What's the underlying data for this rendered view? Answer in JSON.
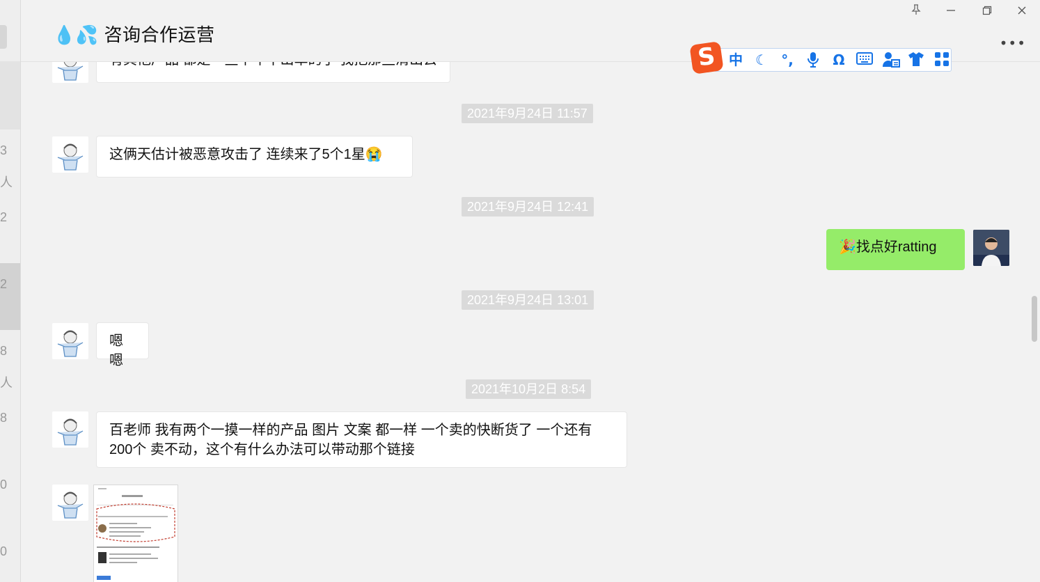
{
  "window": {
    "title": "💧💦 咨询合作运营",
    "pin_icon": "pin-icon",
    "controls": [
      "minimize-icon",
      "restore-icon",
      "close-icon"
    ],
    "more": "•••"
  },
  "left_strip_digits": [
    "3",
    "人",
    "2",
    "2",
    "8",
    "人",
    "8",
    "0",
    "0"
  ],
  "ime_toolbar": {
    "logo": "S",
    "items": [
      "中",
      "☾",
      "°,",
      "mic-icon",
      "Ω",
      "keyboard-icon",
      "user-card-icon",
      "shirt-icon",
      "apps-icon"
    ],
    "accent": "#1673e6",
    "logo_color": "#f25522"
  },
  "messages": {
    "m0": "有其他产品 都是一些半年不出单的了 我把那些清出去",
    "t1": "2021年9月24日 11:57",
    "m1": "这俩天估计被恶意攻击了 连续来了5个1星😭",
    "t2": "2021年9月24日 12:41",
    "m2": "🎉找点好ratting",
    "t3": "2021年9月24日 13:01",
    "m3": "嗯嗯",
    "t4": "2021年10月2日 8:54",
    "m4": "百老师 我有两个一摸一样的产品 图片 文案 都一样 一个卖的快断货了 一个还有200个 卖不动，这个有什么办法可以带动那个链接"
  },
  "colors": {
    "my_bubble": "#95ec69",
    "their_bubble": "#ffffff",
    "timestamp_bg": "#dadada"
  }
}
